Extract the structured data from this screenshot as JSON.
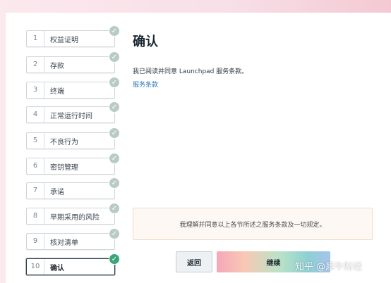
{
  "steps": [
    {
      "num": "1",
      "label": "权益证明",
      "done": true
    },
    {
      "num": "2",
      "label": "存款",
      "done": true
    },
    {
      "num": "3",
      "label": "终端",
      "done": true
    },
    {
      "num": "4",
      "label": "正常运行时间",
      "done": true
    },
    {
      "num": "5",
      "label": "不良行为",
      "done": true
    },
    {
      "num": "6",
      "label": "密钥管理",
      "done": true
    },
    {
      "num": "7",
      "label": "承诺",
      "done": true
    },
    {
      "num": "8",
      "label": "早期采用的风险",
      "done": true
    },
    {
      "num": "9",
      "label": "核对清单",
      "done": true
    },
    {
      "num": "10",
      "label": "确认",
      "done": true,
      "active": true
    }
  ],
  "main": {
    "title": "确认",
    "description": "我已阅读并同意 Launchpad 服务条款。",
    "terms_link": "服务条款",
    "notice": "我理解并同意以上各节所述之服务条款及一切规定。"
  },
  "buttons": {
    "back": "返回",
    "continue": "继续"
  },
  "watermark": "知乎 @犀牛财经",
  "colors": {
    "check_done": "#3aa579",
    "check_pending": "#b9ccc4",
    "link": "#2a79b8"
  }
}
